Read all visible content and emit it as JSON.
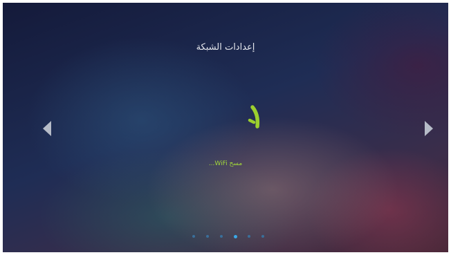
{
  "page": {
    "title": "إعدادات الشبكة",
    "status_text": "مسح WiFi..."
  },
  "navigation": {
    "previous_icon": "left-triangle-icon",
    "next_icon": "right-triangle-icon"
  },
  "spinner": {
    "icon": "loading-spinner-icon",
    "color": "#9ccf2e"
  },
  "pager": {
    "count": 6,
    "active_index": 3,
    "active_color": "#3aa8e8",
    "inactive_color": "#3a6f9a"
  },
  "colors": {
    "status": "#a3d93a",
    "title": "#e6e8ee",
    "arrow": "#b6bcc8"
  }
}
